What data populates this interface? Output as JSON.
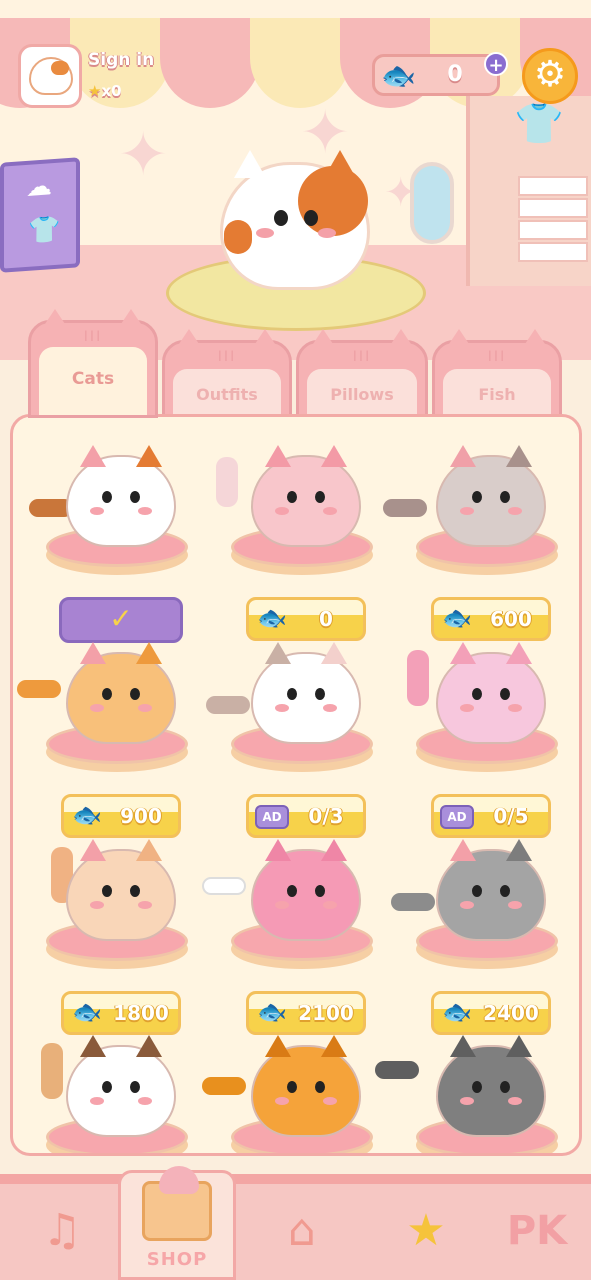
{
  "header": {
    "sign_in": "Sign in",
    "stars": "x0",
    "fish_count": "0",
    "plus": "+",
    "settings": "⚙"
  },
  "tabs": [
    {
      "label": "Cats",
      "active": true
    },
    {
      "label": "Outfits",
      "active": false
    },
    {
      "label": "Pillows",
      "active": false
    },
    {
      "label": "Fish",
      "active": false
    }
  ],
  "items": [
    {
      "status": "owned",
      "check": "✓",
      "color": "#ffffff",
      "patch": "#e47b33",
      "ear": "#e47b33",
      "tail": "#c9763a"
    },
    {
      "price": "0",
      "currency": "fish",
      "color": "#f8c6cb",
      "patch": "#f59aa8",
      "ear": "#f39aa6",
      "tail": "#f5d6d8"
    },
    {
      "price": "600",
      "currency": "fish",
      "color": "#d9cdca",
      "patch": "#b9a7a2",
      "ear": "#a8918c",
      "tail": "#a8918c"
    },
    {
      "price": "900",
      "currency": "fish",
      "color": "#f8c07a",
      "patch": "#ee9a3d",
      "ear": "#ee9a3d",
      "tail": "#ee9a3d"
    },
    {
      "price": "0/3",
      "currency": "ad",
      "ad_label": "AD",
      "color": "#ffffff",
      "patch": "#c9b0a5",
      "ear": "#c9b0a5",
      "tail": "#c9b0a5"
    },
    {
      "price": "0/5",
      "currency": "ad",
      "ad_label": "AD",
      "color": "#f7c7dd",
      "patch": "#f3a0b8",
      "ear": "#f3a0b8",
      "tail": "#f3a0b8"
    },
    {
      "price": "1800",
      "currency": "fish",
      "color": "#f9d6b8",
      "patch": "#f0b283",
      "ear": "#f0b283",
      "tail": "#f0b283"
    },
    {
      "price": "2100",
      "currency": "fish",
      "color": "#f59ab5",
      "patch": "#ef86a6",
      "ear": "#ef86a6",
      "tail": "#ffffff"
    },
    {
      "price": "2400",
      "currency": "fish",
      "color": "#a4a4a4",
      "patch": "#8c8c8c",
      "ear": "#7d7d7d",
      "tail": "#8c8c8c"
    },
    {
      "color": "#ffffff",
      "patch": "#8a5a3a",
      "ear": "#8a5a3a",
      "tail": "#e8b07a"
    },
    {
      "color": "#f5a33a",
      "patch": "#d97b15",
      "ear": "#d97b15",
      "tail": "#e8901e"
    },
    {
      "color": "#7f7f7f",
      "patch": "#5f5f5f",
      "ear": "#5f5f5f",
      "tail": "#5f5f5f"
    }
  ],
  "nav": {
    "music": "♫",
    "shop": "SHOP",
    "home": "⌂",
    "trophy": "★",
    "pk": "PK"
  },
  "colors": {
    "accent_pink": "#f2aaa6",
    "price_yellow": "#f7d24a",
    "owned_purple": "#a883d2"
  }
}
